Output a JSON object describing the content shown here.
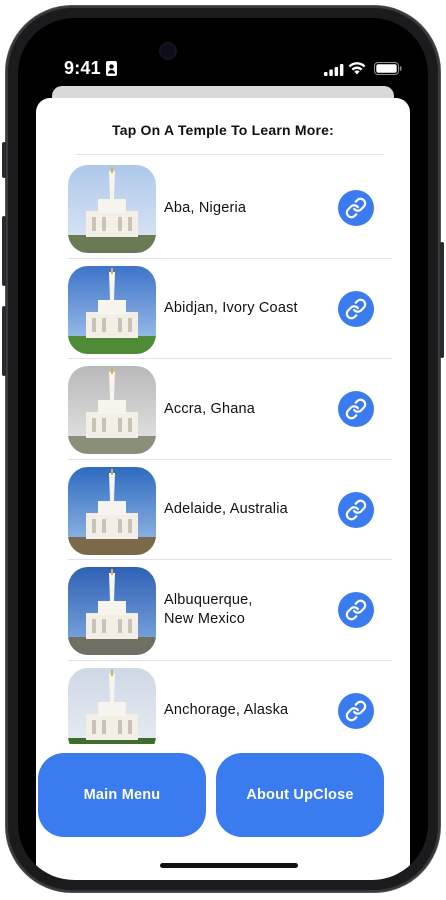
{
  "status_bar": {
    "time": "9:41"
  },
  "header": {
    "title": "Tap On A Temple To Learn More:"
  },
  "temples": [
    {
      "name": "Aba, Nigeria",
      "sky_top": "#aec8ea",
      "sky_bottom": "#dfe8f4",
      "ground": "#6a7a55"
    },
    {
      "name": "Abidjan, Ivory Coast",
      "sky_top": "#3e74c9",
      "sky_bottom": "#a9c8ee",
      "ground": "#4f8a36"
    },
    {
      "name": "Accra, Ghana",
      "sky_top": "#b9b9b9",
      "sky_bottom": "#e6e6e6",
      "ground": "#8a8f7a"
    },
    {
      "name": "Adelaide, Australia",
      "sky_top": "#2f6bc0",
      "sky_bottom": "#9cc0ea",
      "ground": "#7a6a4a"
    },
    {
      "name": "Albuquerque, New Mexico",
      "sky_top": "#2e61b5",
      "sky_bottom": "#86aee3",
      "ground": "#6f6f62"
    },
    {
      "name": "Anchorage, Alaska",
      "sky_top": "#cfd8e6",
      "sky_bottom": "#e9eef4",
      "ground": "#3f6d2e"
    }
  ],
  "buttons": {
    "main_menu": "Main Menu",
    "about": "About UpClose"
  },
  "colors": {
    "accent": "#3a7bf0"
  }
}
